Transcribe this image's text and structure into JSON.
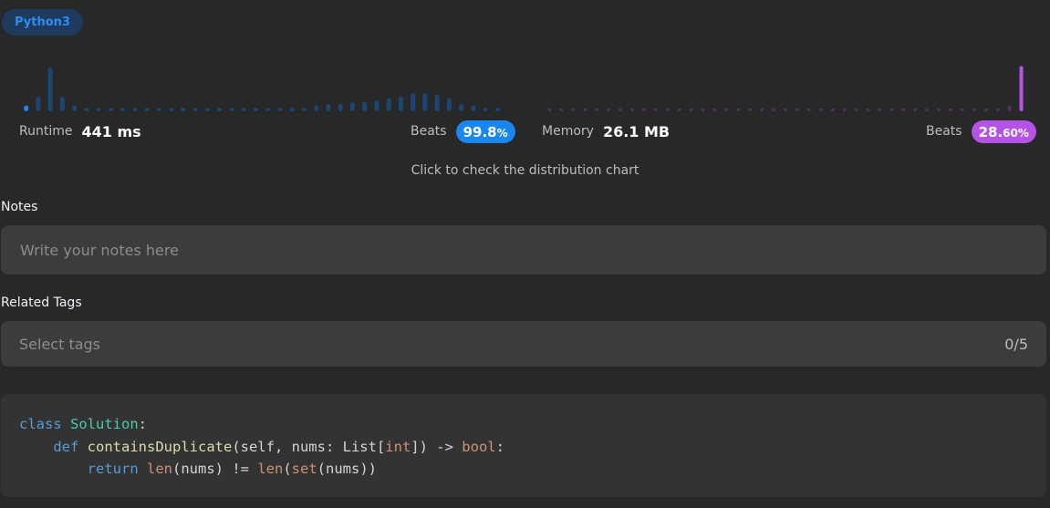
{
  "language_badge": "Python3",
  "runtime": {
    "label": "Runtime",
    "value": "441 ms",
    "beats_label": "Beats",
    "beats_major": "99.8",
    "beats_minor": "%",
    "accent": "#1a86f0",
    "distribution": [
      0.1,
      0.26,
      0.77,
      0.26,
      0.1,
      0.06,
      0.06,
      0.06,
      0.06,
      0.06,
      0.06,
      0.06,
      0.06,
      0.06,
      0.06,
      0.06,
      0.06,
      0.06,
      0.06,
      0.06,
      0.06,
      0.06,
      0.06,
      0.06,
      0.1,
      0.13,
      0.13,
      0.16,
      0.16,
      0.19,
      0.23,
      0.26,
      0.32,
      0.32,
      0.29,
      0.23,
      0.13,
      0.1,
      0.06,
      0.06
    ],
    "highlight_index": 0
  },
  "memory": {
    "label": "Memory",
    "value": "26.1 MB",
    "beats_label": "Beats",
    "beats_major": "28.",
    "beats_minor": "60%",
    "accent": "#b453e6",
    "distribution": [
      0.05,
      0.05,
      0.05,
      0.05,
      0.05,
      0.05,
      0.05,
      0.05,
      0.05,
      0.05,
      0.05,
      0.05,
      0.05,
      0.05,
      0.05,
      0.05,
      0.05,
      0.05,
      0.05,
      0.05,
      0.05,
      0.05,
      0.05,
      0.05,
      0.05,
      0.05,
      0.05,
      0.05,
      0.05,
      0.05,
      0.05,
      0.05,
      0.05,
      0.05,
      0.05,
      0.05,
      0.05,
      0.05,
      0.05,
      0.1,
      0.8
    ],
    "highlight_index": 40
  },
  "distribution_hint": "Click to check the distribution chart",
  "notes": {
    "label": "Notes",
    "placeholder": "Write your notes here"
  },
  "tags": {
    "label": "Related Tags",
    "placeholder": "Select tags",
    "count": "0/5"
  },
  "code": {
    "line1_kw": "class",
    "line1_cls": "Solution",
    "line1_end": ":",
    "line2_indent": "    ",
    "line2_kw": "def",
    "line2_fn": "containsDuplicate",
    "line2_args_a": "(self, nums: List[",
    "line2_ty1": "int",
    "line2_args_b": "]) -> ",
    "line2_ty2": "bool",
    "line2_end": ":",
    "line3_indent": "        ",
    "line3_kw": "return",
    "line3_b1": "len",
    "line3_a": "(nums) != ",
    "line3_b2": "len",
    "line3_p": "(",
    "line3_b3": "set",
    "line3_c": "(nums))"
  }
}
